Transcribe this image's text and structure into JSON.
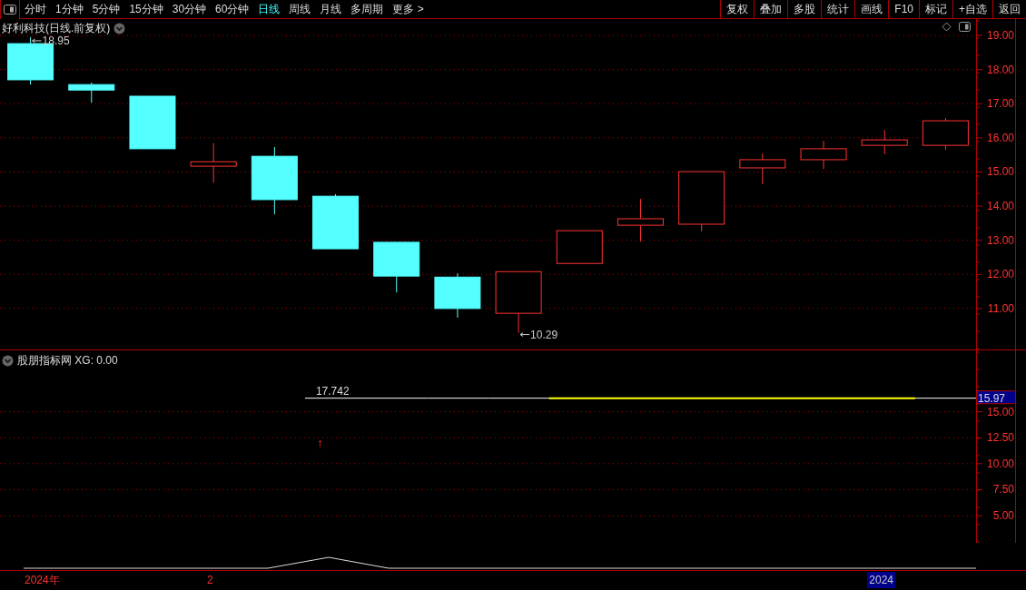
{
  "toolbar": {
    "tabs": [
      {
        "label": "分时",
        "selected": false
      },
      {
        "label": "1分钟",
        "selected": false
      },
      {
        "label": "5分钟",
        "selected": false
      },
      {
        "label": "15分钟",
        "selected": false
      },
      {
        "label": "30分钟",
        "selected": false
      },
      {
        "label": "60分钟",
        "selected": false
      },
      {
        "label": "日线",
        "selected": true
      },
      {
        "label": "周线",
        "selected": false
      },
      {
        "label": "月线",
        "selected": false
      },
      {
        "label": "多周期",
        "selected": false
      },
      {
        "label": "更多 >",
        "selected": false
      }
    ],
    "buttons": [
      "复权",
      "叠加",
      "多股",
      "统计",
      "画线",
      "F10",
      "标记",
      "+自选",
      "返回"
    ]
  },
  "main_chart": {
    "title": "好利科技(日线.前复权)",
    "price_axis": [
      "19.00",
      "18.00",
      "17.00",
      "16.00",
      "15.00",
      "14.00",
      "13.00",
      "12.00",
      "11.00"
    ],
    "high_label": "18.95",
    "low_label": "10.29"
  },
  "indicator": {
    "title": "股朋指标网",
    "reading": "XG: 0.00",
    "current_value": "15.97",
    "value_label": "17.742",
    "signal": "↑",
    "value_axis": [
      "15.00",
      "12.50",
      "10.00",
      "7.50",
      "5.00"
    ]
  },
  "time_axis": {
    "labels": [
      "2024年",
      "2"
    ],
    "current": "2024"
  }
}
